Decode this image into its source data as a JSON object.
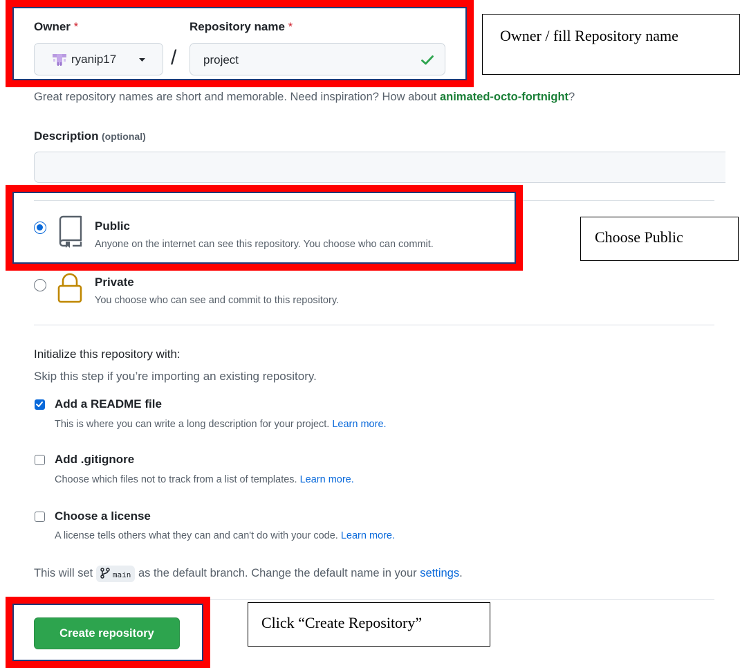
{
  "owner": {
    "label": "Owner",
    "required_mark": "*",
    "value": "ryanip17"
  },
  "repo": {
    "label": "Repository name",
    "required_mark": "*",
    "separator": "/",
    "value": "project"
  },
  "hint": {
    "prefix": "Great repository names are short and memorable. Need inspiration? How about ",
    "suggestion": "animated-octo-fortnight",
    "suffix": "?"
  },
  "description": {
    "label": "Description",
    "optional": "(optional)",
    "value": ""
  },
  "visibility": {
    "public": {
      "title": "Public",
      "desc": "Anyone on the internet can see this repository. You choose who can commit.",
      "selected": true
    },
    "private": {
      "title": "Private",
      "desc": "You choose who can see and commit to this repository.",
      "selected": false
    }
  },
  "init": {
    "heading": "Initialize this repository with:",
    "subheading": "Skip this step if you’re importing an existing repository.",
    "readme": {
      "title": "Add a README file",
      "desc": "This is where you can write a long description for your project. ",
      "link": "Learn more.",
      "checked": true
    },
    "gitignore": {
      "title": "Add .gitignore",
      "desc": "Choose which files not to track from a list of templates. ",
      "link": "Learn more.",
      "checked": false
    },
    "license": {
      "title": "Choose a license",
      "desc": "A license tells others what they can and can't do with your code. ",
      "link": "Learn more.",
      "checked": false
    }
  },
  "branch": {
    "prefix": "This will set ",
    "name": "main",
    "middle": " as the default branch. Change the default name in your ",
    "link": "settings",
    "suffix": "."
  },
  "create_button": "Create repository",
  "callouts": {
    "owner": "Owner / fill Repository name",
    "public": "Choose Public",
    "create": "Click “Create Repository”"
  },
  "colors": {
    "accent": "#0969da",
    "success": "#2da44e",
    "highlight": "#ff0000"
  }
}
